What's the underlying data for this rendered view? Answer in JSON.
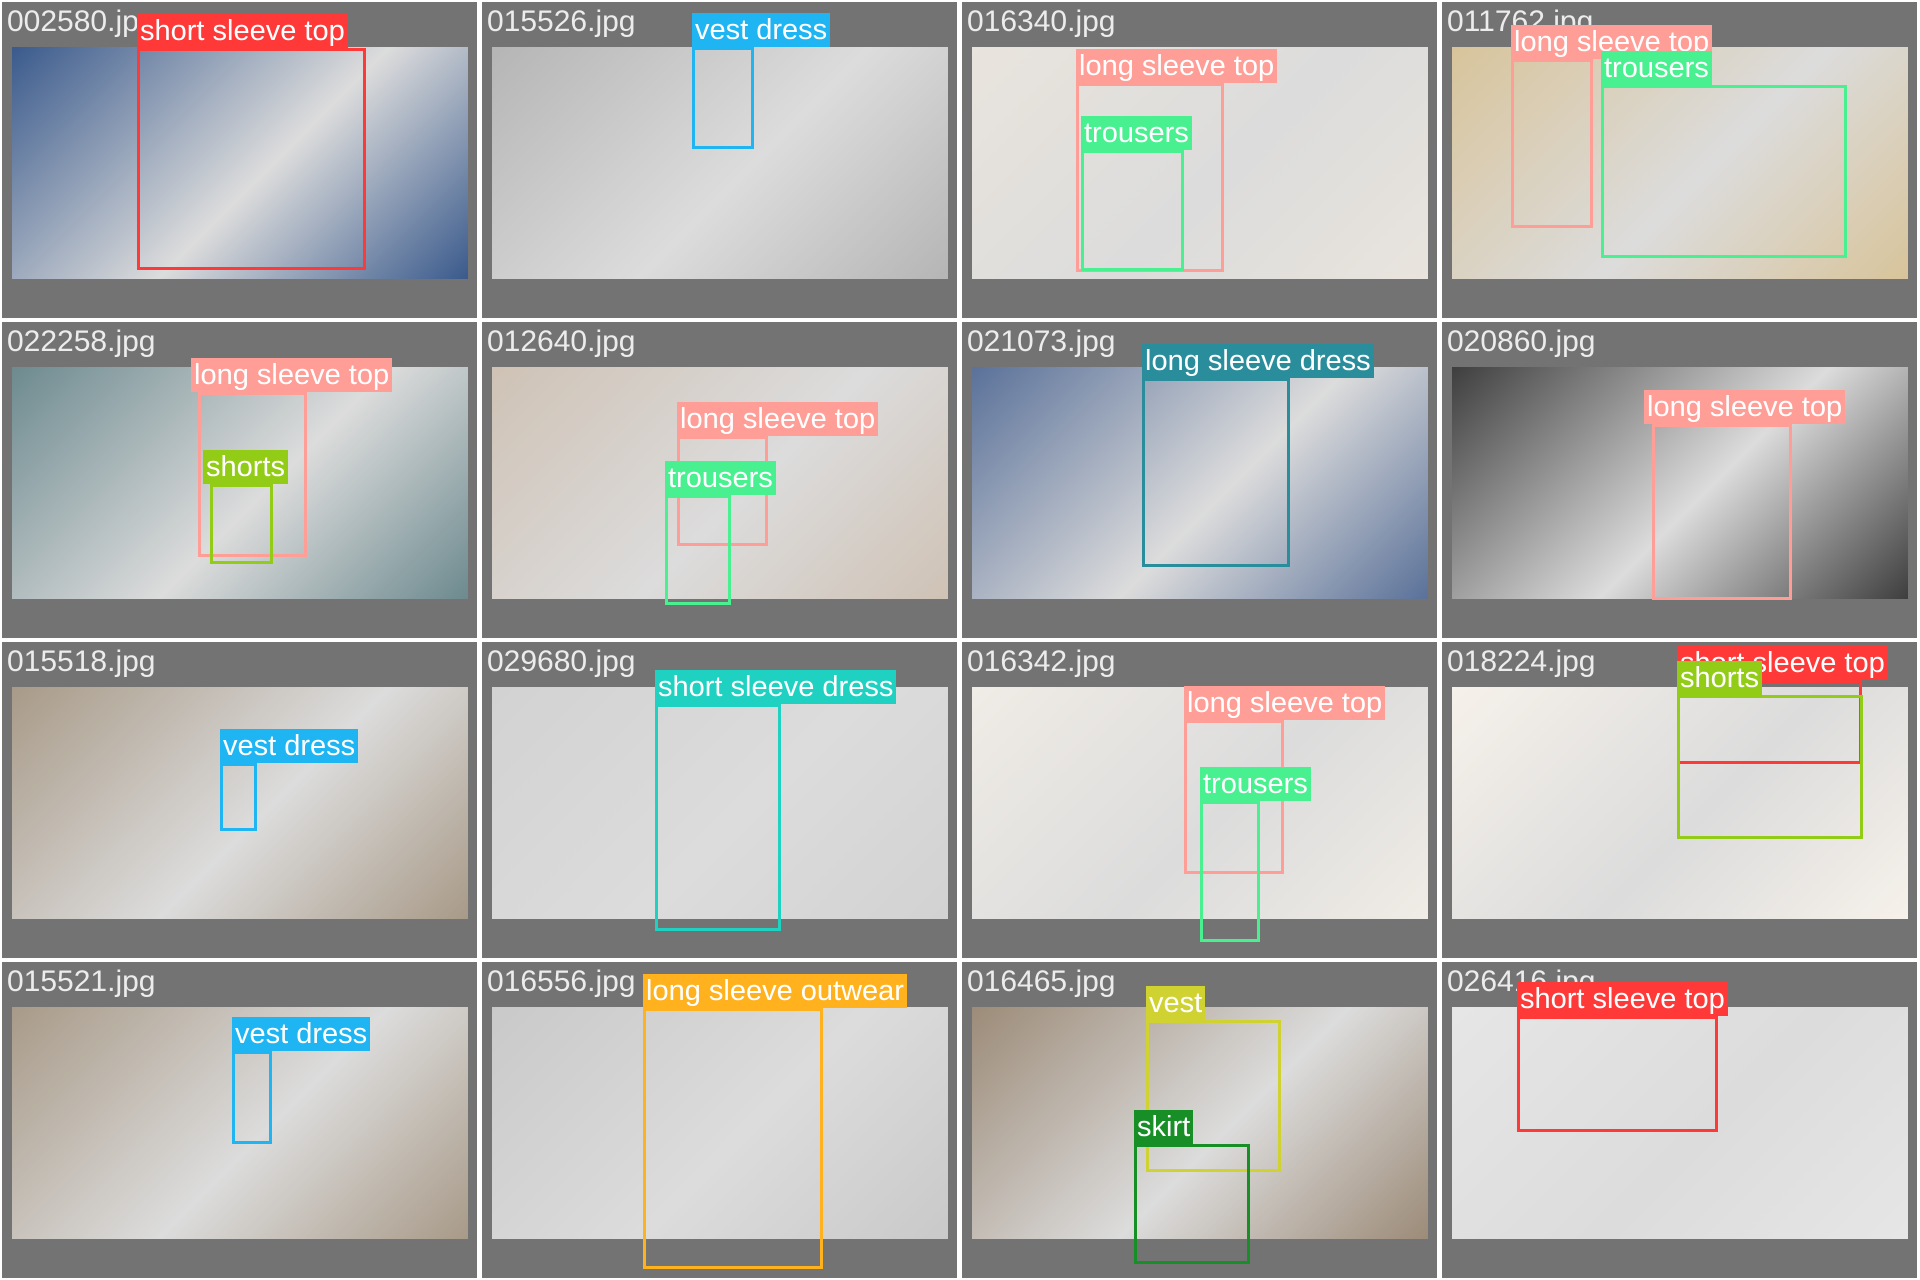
{
  "palette": {
    "short sleeve top": "#ff3838",
    "long sleeve top": "#ff9d97",
    "vest dress": "#1fb4f2",
    "trousers": "#48f090",
    "shorts": "#92cc17",
    "long sleeve dress": "#2a8d9c",
    "short sleeve dress": "#1fd1c0",
    "long sleeve outwear": "#ffb21d",
    "vest": "#cfd231",
    "skirt": "#188f26"
  },
  "tiles": [
    {
      "file": "002580.jpg",
      "scene": "#3a5a8c",
      "labels": [
        {
          "cls": "short sleeve top"
        }
      ]
    },
    {
      "file": "015526.jpg",
      "scene": "#b5b5b5",
      "labels": [
        {
          "cls": "vest dress"
        }
      ]
    },
    {
      "file": "016340.jpg",
      "scene": "#e9e4dd",
      "labels": [
        {
          "cls": "long sleeve top"
        },
        {
          "cls": "trousers"
        }
      ]
    },
    {
      "file": "011762.jpg",
      "scene": "#d8c49b",
      "labels": [
        {
          "cls": "long sleeve top"
        },
        {
          "cls": "trousers"
        }
      ]
    },
    {
      "file": "022258.jpg",
      "scene": "#6d8a8f",
      "labels": [
        {
          "cls": "long sleeve top"
        },
        {
          "cls": "shorts"
        }
      ]
    },
    {
      "file": "012640.jpg",
      "scene": "#cfc2b5",
      "labels": [
        {
          "cls": "long sleeve top"
        },
        {
          "cls": "trousers"
        }
      ]
    },
    {
      "file": "021073.jpg",
      "scene": "#5a7199",
      "labels": [
        {
          "cls": "long sleeve dress"
        }
      ]
    },
    {
      "file": "020860.jpg",
      "scene": "#3e3e3e",
      "labels": [
        {
          "cls": "long sleeve top"
        }
      ]
    },
    {
      "file": "015518.jpg",
      "scene": "#a89a88",
      "labels": [
        {
          "cls": "vest dress"
        }
      ]
    },
    {
      "file": "029680.jpg",
      "scene": "#d2d2d2",
      "labels": [
        {
          "cls": "short sleeve dress"
        }
      ]
    },
    {
      "file": "016342.jpg",
      "scene": "#f0ece6",
      "labels": [
        {
          "cls": "long sleeve top"
        },
        {
          "cls": "trousers"
        }
      ]
    },
    {
      "file": "018224.jpg",
      "scene": "#f6f1ea",
      "labels": [
        {
          "cls": "short sleeve top"
        },
        {
          "cls": "shorts"
        }
      ]
    },
    {
      "file": "015521.jpg",
      "scene": "#a89a88",
      "labels": [
        {
          "cls": "vest dress"
        }
      ]
    },
    {
      "file": "016556.jpg",
      "scene": "#c9c9c9",
      "labels": [
        {
          "cls": "long sleeve outwear"
        }
      ]
    },
    {
      "file": "016465.jpg",
      "scene": "#9c8b78",
      "labels": [
        {
          "cls": "vest"
        },
        {
          "cls": "skirt"
        }
      ]
    },
    {
      "file": "026416.jpg",
      "scene": "#e6e6e6",
      "labels": [
        {
          "cls": "short sleeve top"
        }
      ]
    }
  ]
}
